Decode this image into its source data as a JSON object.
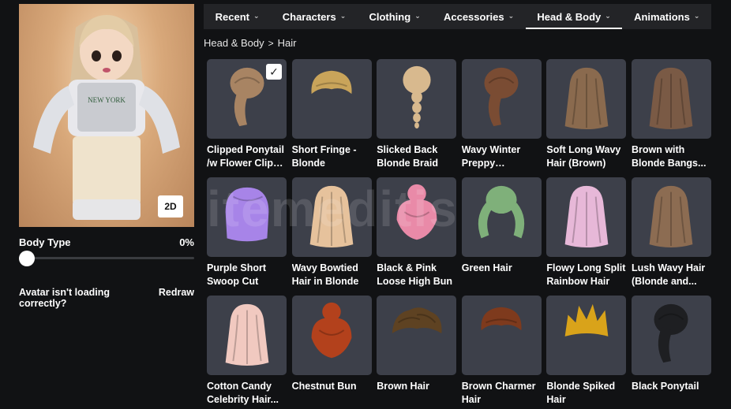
{
  "avatar": {
    "view_toggle_label": "2D",
    "body_type_label": "Body Type",
    "body_type_value_text": "0%",
    "body_type_value": 0,
    "redraw_prompt": "Avatar isn't loading correctly?",
    "redraw_label": "Redraw"
  },
  "tabs": [
    {
      "label": "Recent",
      "active": false
    },
    {
      "label": "Characters",
      "active": false
    },
    {
      "label": "Clothing",
      "active": false
    },
    {
      "label": "Accessories",
      "active": false
    },
    {
      "label": "Head & Body",
      "active": true
    },
    {
      "label": "Animations",
      "active": false
    }
  ],
  "breadcrumb": {
    "parent": "Head & Body",
    "separator": ">",
    "current": "Hair"
  },
  "watermark_text": "itemeditis",
  "items": [
    {
      "name": "Clipped Ponytail /w Flower Clip I...",
      "equipped": true,
      "color": "#a88463",
      "style": "ponytail"
    },
    {
      "name": "Short Fringe - Blonde",
      "equipped": false,
      "color": "#c9a45a",
      "style": "short"
    },
    {
      "name": "Slicked Back Blonde Braid",
      "equipped": false,
      "color": "#d8b98e",
      "style": "braid"
    },
    {
      "name": "Wavy Winter Preppy Ponytail...",
      "equipped": false,
      "color": "#7a4c33",
      "style": "ponytail"
    },
    {
      "name": "Soft Long Wavy Hair (Brown)",
      "equipped": false,
      "color": "#8a6a4e",
      "style": "long"
    },
    {
      "name": "Brown with Blonde Bangs...",
      "equipped": false,
      "color": "#7a5a45",
      "style": "long"
    },
    {
      "name": "Purple Short Swoop Cut",
      "equipped": false,
      "color": "#a784e8",
      "style": "bob"
    },
    {
      "name": "Wavy Bowtied Hair in Blonde",
      "equipped": false,
      "color": "#e6c29c",
      "style": "long"
    },
    {
      "name": "Black & Pink Loose High Bun",
      "equipped": false,
      "color": "#e98aa8",
      "style": "bun"
    },
    {
      "name": "Green Hair",
      "equipped": false,
      "color": "#7fb07a",
      "style": "pigtails"
    },
    {
      "name": "Flowy Long Split Rainbow Hair",
      "equipped": false,
      "color": "#e7b8d8",
      "style": "long"
    },
    {
      "name": "Lush Wavy Hair (Blonde and...",
      "equipped": false,
      "color": "#8c6c52",
      "style": "long"
    },
    {
      "name": "Cotton Candy Celebrity Hair...",
      "equipped": false,
      "color": "#f1c9c0",
      "style": "long"
    },
    {
      "name": "Chestnut Bun",
      "equipped": false,
      "color": "#b3411c",
      "style": "bun"
    },
    {
      "name": "Brown Hair",
      "equipped": false,
      "color": "#5e4222",
      "style": "messy"
    },
    {
      "name": "Brown Charmer Hair",
      "equipped": false,
      "color": "#7e3a1d",
      "style": "short"
    },
    {
      "name": "Blonde Spiked Hair",
      "equipped": false,
      "color": "#d9a31a",
      "style": "spiky"
    },
    {
      "name": "Black Ponytail",
      "equipped": false,
      "color": "#1e1f22",
      "style": "ponytail"
    }
  ]
}
